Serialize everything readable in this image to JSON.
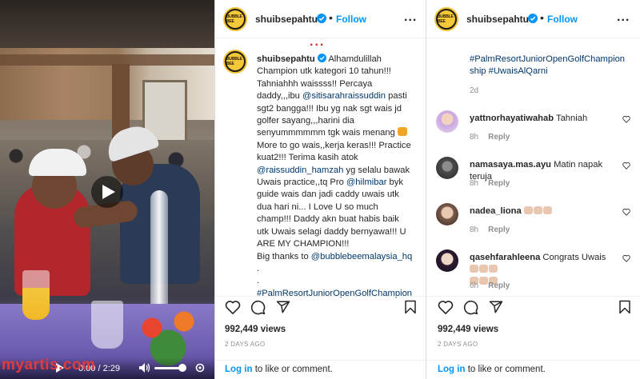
{
  "video": {
    "current_time": "0:00",
    "duration": "2:29",
    "time_sep": "/",
    "volume_level": 0.8,
    "watermark": "myartis.com"
  },
  "post": {
    "username": "shuibsepahtu",
    "follow_label": "Follow",
    "dot_sep": "•",
    "more_label": "...",
    "avatar_text": "BUBBLE BEE",
    "caption_lines": [
      "Alhamdulillah",
      "Champion utk kategori 10 tahun!!!",
      "Tahniahhh waissss!! Percaya",
      "daddy,,,ibu ",
      "sgt2 bangga!!! Ibu yg nak sgt wais jd",
      "golfer sayang,,,harini dia",
      "senyummmmmm tgk wais menang ",
      "More to go wais,,kerja keras!!! Practice",
      "kuat2!!! Terima kasih atok",
      "",
      "Uwais practice,,tq Pro ",
      "guide wais dan jadi caddy uwais utk",
      "dua hari ni... I Love U so much",
      "champ!!! Daddy akn buat habis baik",
      "utk Uwais selagi daddy bernyawa!!! U",
      "ARE MY CHAMPION!!!",
      "Big thanks to ",
      ".",
      ".",
      ""
    ],
    "mention_sitisarah": "@sitisarahraissuddin",
    "pasti_word": " pasti",
    "mention_raissuddin": "@raissuddin_hamzah",
    "raissuddin_tail": " yg selalu bawak",
    "mention_hilmibar": "@hilmibar",
    "hilmibar_tail": " byk",
    "mention_bubblebee": "@bubblebeemalaysia_hq",
    "hashtag_left": "#PalmResortJuniorOpenGolfChampion",
    "views": "992,449 views",
    "ago": "2 DAYS AGO",
    "login_link": "Log in",
    "login_rest": " to like or comment."
  },
  "right_panel": {
    "hashtag_lines": [
      "#PalmResortJuniorOpenGolfChampion",
      "ship #UwaisAlQarni"
    ],
    "caption_age": "2d",
    "comments": [
      {
        "user": "yattnorhayatiwahab",
        "text": "Tahniah",
        "age": "8h",
        "reply": "Reply"
      },
      {
        "user": "namasaya.mas.ayu",
        "text": "Matin napak teruja",
        "age": "8h",
        "reply": "Reply"
      },
      {
        "user": "nadea_liona",
        "text": "",
        "age": "8h",
        "reply": "Reply"
      },
      {
        "user": "qasehfarahleena",
        "text": "Congrats Uwais",
        "age": "6h",
        "reply": "Reply"
      }
    ],
    "views": "992,449 views",
    "ago": "2 DAYS AGO",
    "login_link": "Log in",
    "login_rest": " to like or comment."
  },
  "colors": {
    "link_blue": "#0095f6",
    "mention_blue": "#00376b",
    "meta_gray": "#8e8e8e",
    "red_dots": "#d9262b",
    "avatar_ring": "#f2c230"
  },
  "icons": [
    "play-icon",
    "volume-icon",
    "settings-icon",
    "verified-icon",
    "heart-icon",
    "comment-icon",
    "share-icon",
    "bookmark-icon",
    "more-icon"
  ]
}
